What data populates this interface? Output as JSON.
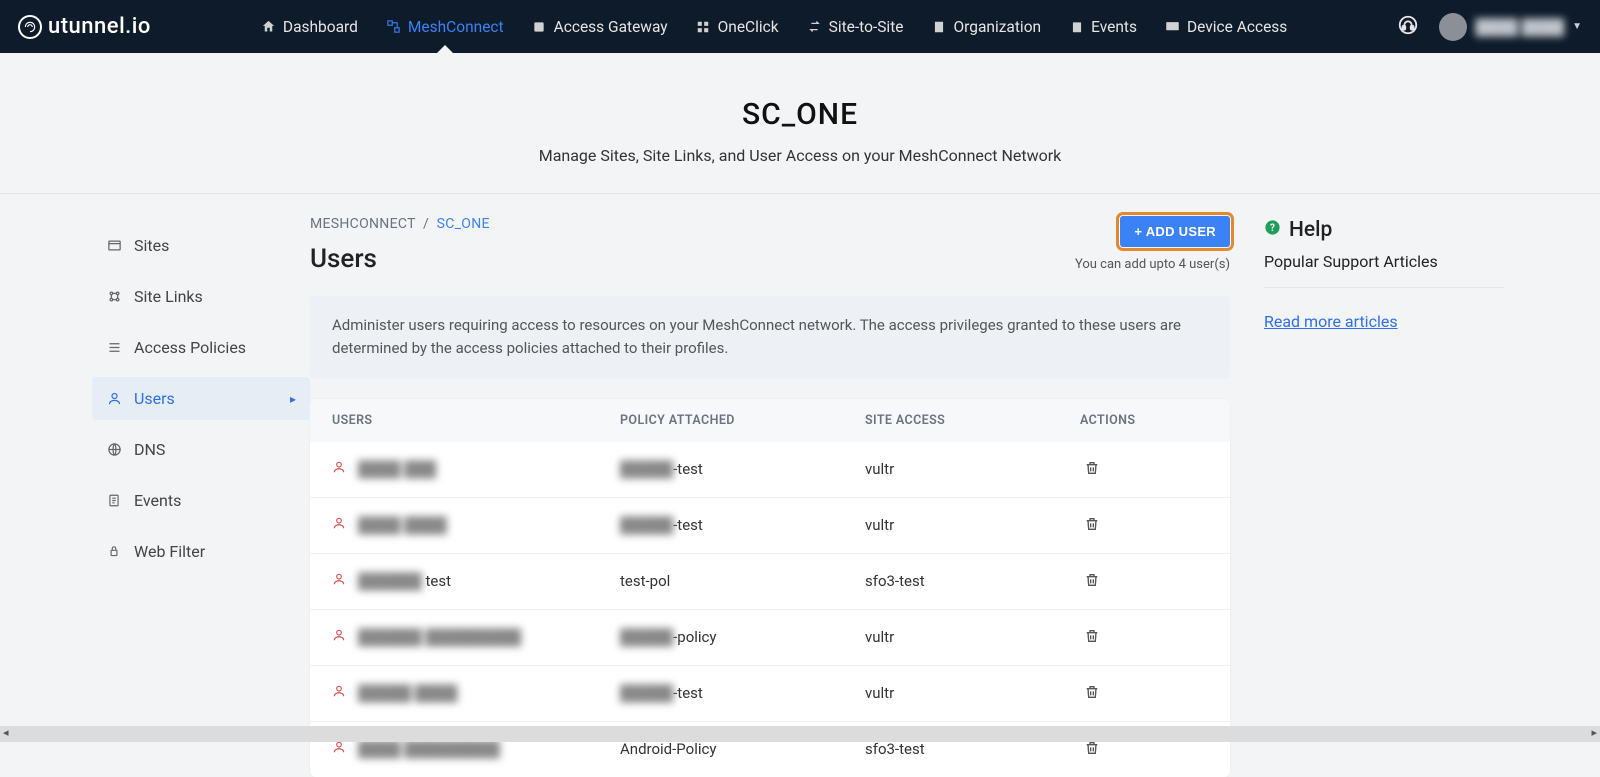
{
  "brand": "utunnel.io",
  "nav": [
    {
      "label": "Dashboard",
      "icon": "home"
    },
    {
      "label": "MeshConnect",
      "icon": "mesh",
      "active": true
    },
    {
      "label": "Access Gateway",
      "icon": "gateway"
    },
    {
      "label": "OneClick",
      "icon": "grid"
    },
    {
      "label": "Site-to-Site",
      "icon": "arrows"
    },
    {
      "label": "Organization",
      "icon": "org"
    },
    {
      "label": "Events",
      "icon": "events"
    },
    {
      "label": "Device Access",
      "icon": "device"
    }
  ],
  "user_name_masked": "████ ████",
  "page": {
    "title": "SC_ONE",
    "subtitle": "Manage Sites, Site Links, and User Access on your MeshConnect Network"
  },
  "sidebar": [
    {
      "label": "Sites",
      "icon": "sites"
    },
    {
      "label": "Site Links",
      "icon": "links"
    },
    {
      "label": "Access Policies",
      "icon": "policies"
    },
    {
      "label": "Users",
      "icon": "users",
      "active": true
    },
    {
      "label": "DNS",
      "icon": "dns"
    },
    {
      "label": "Events",
      "icon": "events2"
    },
    {
      "label": "Web Filter",
      "icon": "filter"
    }
  ],
  "breadcrumb": {
    "root": "MESHCONNECT",
    "current": "SC_ONE"
  },
  "section_title": "Users",
  "add_user_label": "+ ADD USER",
  "limit_note": "You can add upto 4 user(s)",
  "info_text": "Administer users requiring access to resources on your MeshConnect network. The access privileges granted to these users are determined by the access policies attached to their profiles.",
  "table": {
    "headers": {
      "users": "USERS",
      "policy": "POLICY ATTACHED",
      "site": "SITE ACCESS",
      "actions": "ACTIONS"
    },
    "rows": [
      {
        "user_masked": "████ ███",
        "user_suffix": "",
        "policy_masked": "█████",
        "policy_suffix": "-test",
        "site": "vultr"
      },
      {
        "user_masked": "████ ████",
        "user_suffix": "",
        "policy_masked": "█████",
        "policy_suffix": "-test",
        "site": "vultr"
      },
      {
        "user_masked": "██████",
        "user_suffix": " test",
        "policy_masked": "",
        "policy_suffix": "test-pol",
        "site": "sfo3-test"
      },
      {
        "user_masked": "██████ █████████",
        "user_suffix": "",
        "policy_masked": "█████",
        "policy_suffix": "-policy",
        "site": "vultr"
      },
      {
        "user_masked": "█████ ████",
        "user_suffix": "",
        "policy_masked": "█████",
        "policy_suffix": "-test",
        "site": "vultr"
      },
      {
        "user_masked": "████ █████████",
        "user_suffix": "",
        "policy_masked": "",
        "policy_suffix": "Android-Policy",
        "site": "sfo3-test"
      }
    ]
  },
  "help": {
    "title": "Help",
    "subtitle": "Popular Support Articles",
    "link": "Read more articles"
  }
}
